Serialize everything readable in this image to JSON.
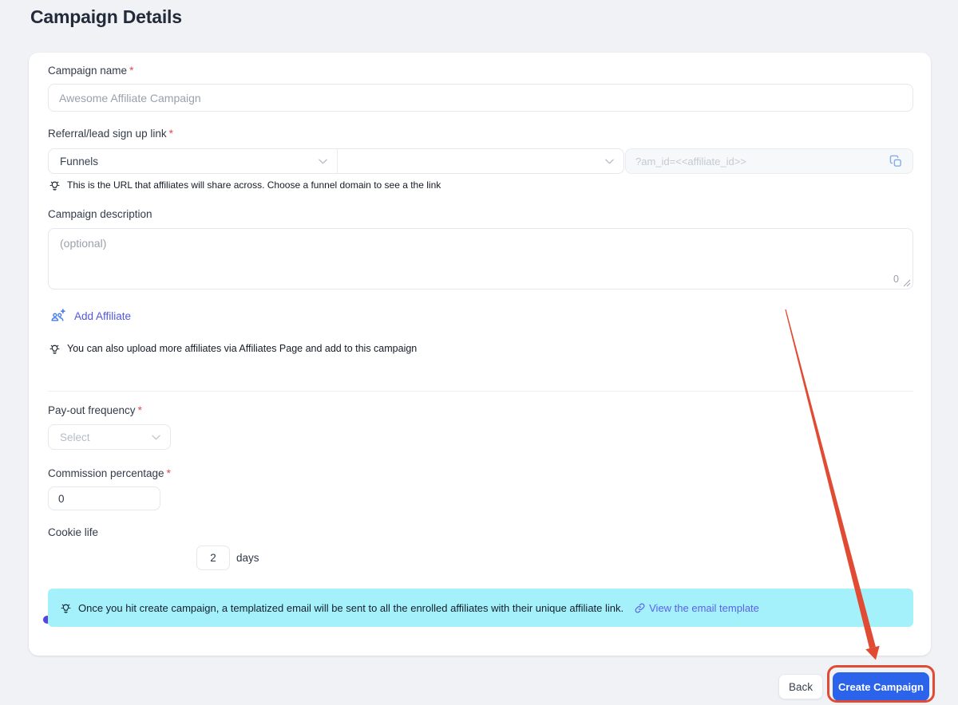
{
  "page": {
    "title": "Campaign Details"
  },
  "form": {
    "campaign_name": {
      "label": "Campaign name",
      "required_mark": "*",
      "placeholder": "Awesome Affiliate Campaign"
    },
    "referral_link": {
      "label": "Referral/lead sign up link",
      "required_mark": "*",
      "source_select_value": "Funnels",
      "link_placeholder": "?am_id=<<affiliate_id>>",
      "tip": "This is the URL that affiliates will share across. Choose a funnel domain to see a the link"
    },
    "description": {
      "label": "Campaign description",
      "placeholder": "(optional)",
      "char_count": "0"
    },
    "add_affiliate": {
      "label": "Add Affiliate",
      "tip": "You can also upload more affiliates via Affiliates Page and add to this campaign"
    },
    "payout_frequency": {
      "label": "Pay-out frequency",
      "required_mark": "*",
      "placeholder": "Select"
    },
    "commission": {
      "label": "Commission percentage",
      "required_mark": "*",
      "value": "0"
    },
    "cookie_life": {
      "label": "Cookie life",
      "value": "2",
      "unit": "days"
    },
    "banner": {
      "text": "Once you hit create campaign, a templatized email will be sent to all the enrolled affiliates with their unique affiliate link.",
      "link_label": "View the email template"
    }
  },
  "footer": {
    "back_label": "Back",
    "create_label": "Create Campaign"
  },
  "icons": {
    "bulb": "lightbulb-tip",
    "chevron_down": "chevron-down",
    "copy": "copy-duplicate",
    "add_affiliate": "people-group-plus",
    "link": "chain-link"
  },
  "colors": {
    "page_background": "#f1f2f6",
    "primary_button": "#2b63eb",
    "banner_background": "#a5f1fb",
    "annotation_red": "#e14b33",
    "slider_thumb": "#5247d8",
    "link_purple": "#5a61e8",
    "required_red": "#e5484d"
  }
}
